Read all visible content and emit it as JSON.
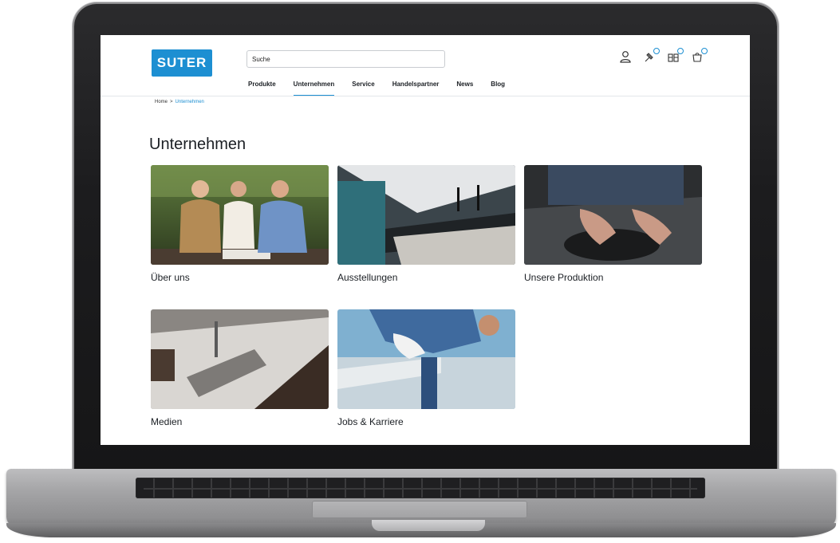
{
  "header": {
    "logo": "SUTER",
    "search_placeholder": "Suche",
    "nav": [
      "Produkte",
      "Unternehmen",
      "Service",
      "Handelspartner",
      "News",
      "Blog"
    ],
    "active_nav": "Unternehmen",
    "icons": [
      "user-icon",
      "pin-icon",
      "compare-icon",
      "cart-icon"
    ]
  },
  "breadcrumb": {
    "home": "Home",
    "separator": ">",
    "current": "Unternehmen"
  },
  "page_title": "Unternehmen",
  "cards": [
    {
      "label": "Über uns"
    },
    {
      "label": "Ausstellungen"
    },
    {
      "label": "Unsere Produktion"
    },
    {
      "label": "Medien"
    },
    {
      "label": "Jobs & Karriere"
    }
  ],
  "colors": {
    "accent": "#1d8fd2",
    "text": "#1b1f24",
    "laptop": "#1c1c1e"
  }
}
